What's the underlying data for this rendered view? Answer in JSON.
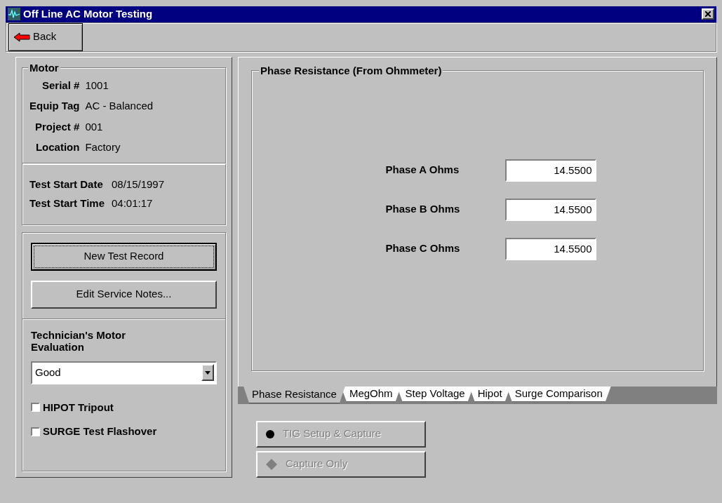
{
  "window": {
    "title": "Off Line AC Motor Testing"
  },
  "toolbar": {
    "back_button": "Back"
  },
  "motor": {
    "title": "Motor",
    "fields": [
      {
        "label": "Serial #",
        "value": "1001"
      },
      {
        "label": "Equip Tag",
        "value": "AC - Balanced"
      },
      {
        "label": "Project #",
        "value": "001"
      },
      {
        "label": "Location",
        "value": "Factory"
      }
    ]
  },
  "test_start": [
    {
      "label": "Test Start Date",
      "value": "08/15/1997"
    },
    {
      "label": "Test Start Time",
      "value": "04:01:17"
    }
  ],
  "record_buttons": [
    {
      "label": "New Test Record",
      "default": true
    },
    {
      "label": "Edit Service Notes...",
      "default": false
    }
  ],
  "evaluation": {
    "label": "Technician's Motor Evaluation",
    "value": "Good"
  },
  "checkboxes": [
    {
      "label": "HIPOT Tripout",
      "checked": false
    },
    {
      "label": "SURGE Test Flashover",
      "checked": false
    }
  ],
  "phase_panel": {
    "title": "Phase Resistance (From Ohmmeter)",
    "fields": [
      {
        "label": "Phase A Ohms",
        "value": "14.5500"
      },
      {
        "label": "Phase B Ohms",
        "value": "14.5500"
      },
      {
        "label": "Phase C Ohms",
        "value": "14.5500"
      }
    ]
  },
  "tabs": [
    {
      "label": "Phase Resistance",
      "selected": true
    },
    {
      "label": "MegOhm",
      "selected": false
    },
    {
      "label": "Step Voltage",
      "selected": false
    },
    {
      "label": "Hipot",
      "selected": false
    },
    {
      "label": "Surge Comparison",
      "selected": false
    }
  ],
  "capture_buttons": [
    {
      "label": "TIG Setup & Capture",
      "kind": "circle",
      "disabled": true
    },
    {
      "label": "Capture Only",
      "kind": "diamond",
      "disabled": true
    }
  ]
}
